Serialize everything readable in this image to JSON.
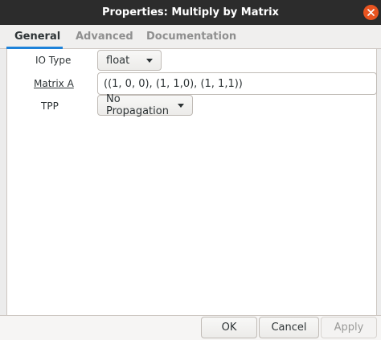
{
  "window": {
    "title": "Properties: Multiply by Matrix",
    "close_icon": "close-icon"
  },
  "tabs": [
    {
      "label": "General",
      "active": true
    },
    {
      "label": "Advanced",
      "active": false
    },
    {
      "label": "Documentation",
      "active": false
    }
  ],
  "fields": {
    "io_type": {
      "label": "IO Type",
      "value": "float"
    },
    "matrix_a": {
      "label": "Matrix A",
      "value": "((1, 0, 0), (1, 1,0), (1, 1,1))"
    },
    "tpp": {
      "label": "TPP",
      "value": "No Propagation"
    }
  },
  "buttons": {
    "ok": "OK",
    "cancel": "Cancel",
    "apply": "Apply"
  },
  "colors": {
    "accent": "#1e82d9",
    "titlebar": "#2c2c2c",
    "close": "#e95420"
  }
}
